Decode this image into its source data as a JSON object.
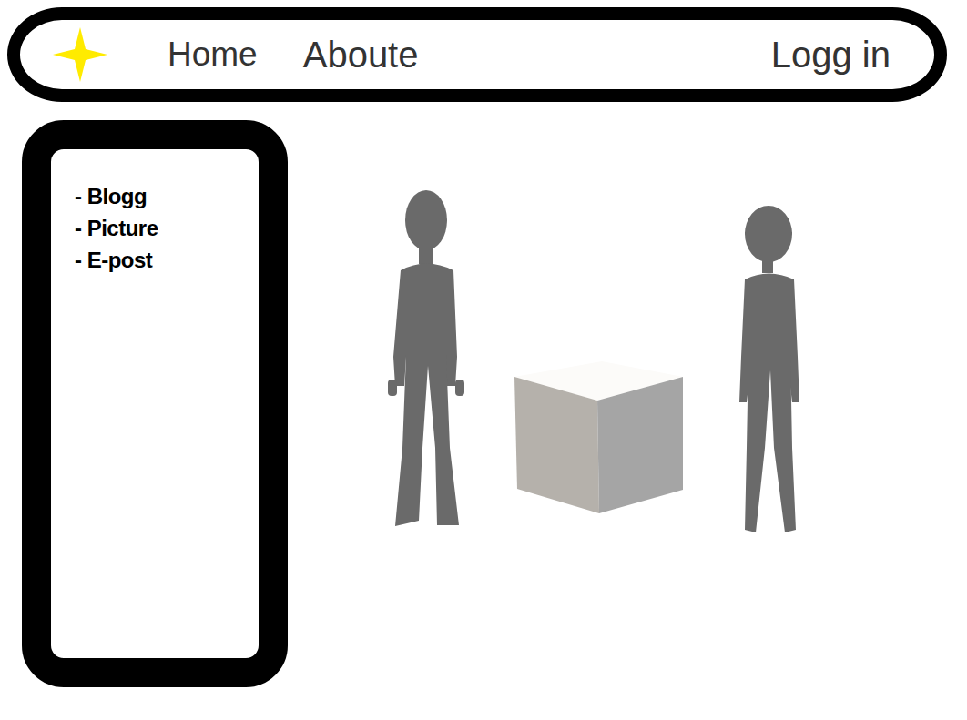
{
  "nav": {
    "links": [
      {
        "label": "Home"
      },
      {
        "label": "Aboute"
      }
    ],
    "login": "Logg in"
  },
  "sidebar": {
    "items": [
      "- Blogg",
      "- Picture",
      "- E-post"
    ]
  }
}
